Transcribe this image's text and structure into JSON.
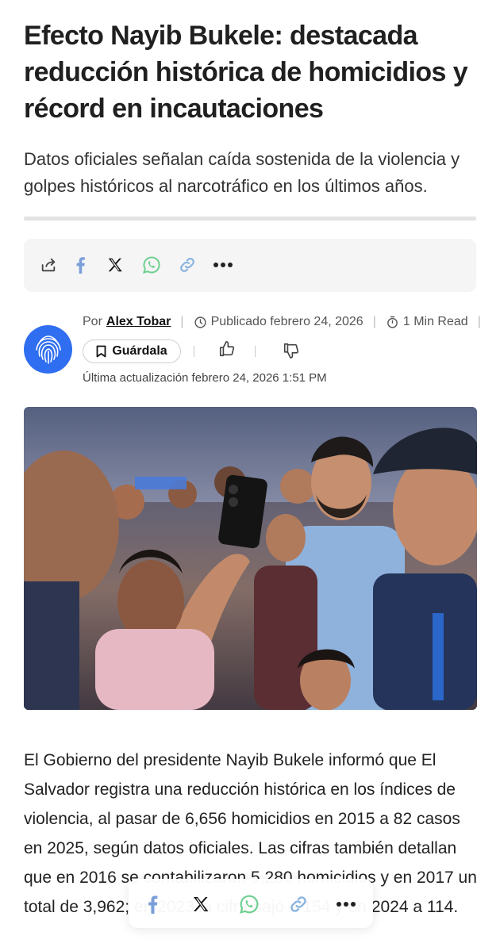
{
  "article": {
    "title": "Efecto Nayib Bukele: destacada reducción histórica de homicidios y récord en incautaciones",
    "subtitle": "Datos oficiales señalan caída sostenida de la violencia y golpes históricos al narcotráfico en los últimos años.",
    "body": "El Gobierno del presidente Nayib Bukele informó que El Salvador registra una reducción histórica en los índices de violencia, al pasar de 6,656 homicidios en 2015 a 82 casos en 2025, según datos oficiales. Las cifras también detallan que en 2016 se contabilizaron 5,280 homicidios y en 2017 un total de 3,962; en 2023 la cifra bajó a 154 y en 2024 a 114."
  },
  "share": {
    "icons": [
      "share-icon",
      "facebook-icon",
      "x-icon",
      "whatsapp-icon",
      "link-icon",
      "more-icon"
    ],
    "colors": {
      "facebook": "#1877F2",
      "x": "#111111",
      "whatsapp": "#25D366",
      "link": "#3a8dde",
      "bar_bg": "#f5f5f5"
    }
  },
  "meta": {
    "by_label": "Por",
    "author": "Alex Tobar",
    "published": "Publicado febrero 24, 2026",
    "read_time": "1 Min Read",
    "save_label": "Guárdala",
    "updated": "Última actualización febrero 24, 2026 1:51 PM",
    "avatar_color": "#2f6ef0"
  },
  "photo": {
    "icon": "photo-crowd-selfie"
  }
}
